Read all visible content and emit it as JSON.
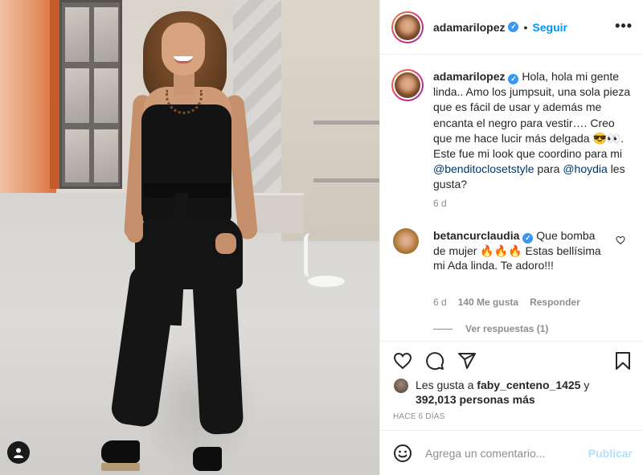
{
  "post": {
    "username": "adamarilopez",
    "verified_mark": "✓",
    "separator": "•",
    "follow_label": "Seguir",
    "more_label": "•••"
  },
  "caption": {
    "username": "adamarilopez",
    "text_part1": "Hola, hola mi gente linda.. Amo los jumpsuit, una sola pieza que es fácil de usar y además me encanta el negro para vestir…. Creo que me hace lucir más delgada 😎👀. Este fue mi look que coordino para mi ",
    "mention1": "@benditoclosetstyle",
    "text_part2": " para ",
    "mention2": "@hoydia",
    "text_part3": " les gusta?",
    "time": "6 d"
  },
  "comment": {
    "username": "betancurclaudia",
    "text": "Que bomba de mujer 🔥🔥🔥 Estas bellísima mi Ada linda. Te adoro!!!",
    "time": "6 d",
    "likes": "140 Me gusta",
    "reply_label": "Responder",
    "view_replies": "Ver respuestas (1)"
  },
  "likes": {
    "prefix": "Les gusta a ",
    "user": "faby_centeno_1425",
    "conj": " y",
    "count": "392,013 personas más"
  },
  "timestamp": "HACE 6 DÍAS",
  "comment_input": {
    "placeholder": "Agrega un comentario...",
    "publish_label": "Publicar"
  },
  "icons": {
    "like": "heart-icon",
    "comment": "comment-icon",
    "share": "share-icon",
    "save": "bookmark-icon",
    "emoji": "emoji-icon",
    "tag": "user-tag-icon"
  },
  "colors": {
    "accent": "#0095f6",
    "verified": "#3897f0",
    "muted": "#8e8e8e",
    "publish_disabled": "#b2dffc"
  }
}
